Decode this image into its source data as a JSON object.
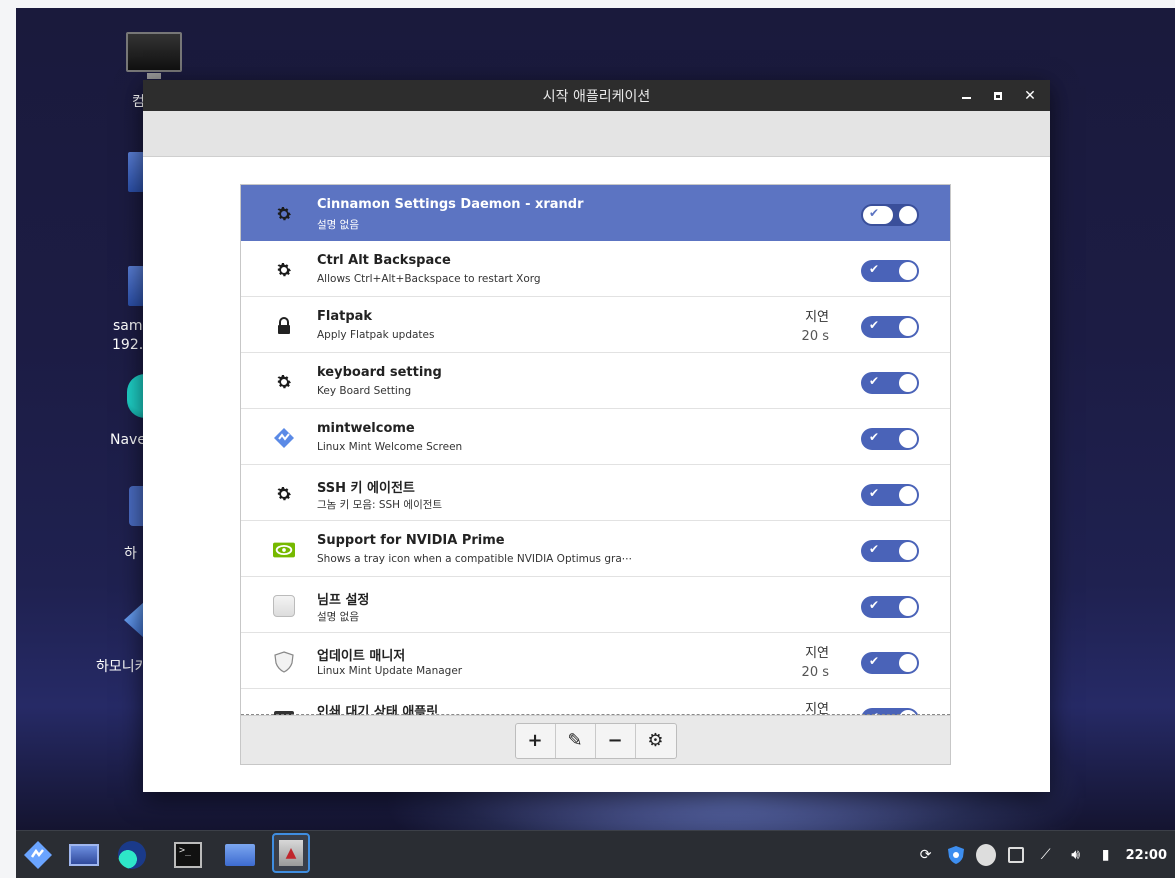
{
  "window": {
    "title": "시작 애플리케이션"
  },
  "desktop": {
    "labels": [
      "컴",
      "sam",
      "192.",
      "Nave",
      "하",
      "하모니카"
    ]
  },
  "startup_apps": [
    {
      "title": "Cinnamon Settings Daemon - xrandr",
      "description": "설명 없음",
      "icon": "gear-icon",
      "delay_label": "",
      "delay_value": "",
      "enabled": true,
      "selected": true
    },
    {
      "title": "Ctrl Alt Backspace",
      "description": "Allows Ctrl+Alt+Backspace to restart Xorg",
      "icon": "gear-icon",
      "delay_label": "",
      "delay_value": "",
      "enabled": true,
      "selected": false
    },
    {
      "title": "Flatpak",
      "description": "Apply Flatpak updates",
      "icon": "lock-icon",
      "delay_label": "지연",
      "delay_value": "20 s",
      "enabled": true,
      "selected": false
    },
    {
      "title": "keyboard setting",
      "description": "Key Board Setting",
      "icon": "gear-icon",
      "delay_label": "",
      "delay_value": "",
      "enabled": true,
      "selected": false
    },
    {
      "title": "mintwelcome",
      "description": "Linux Mint Welcome Screen",
      "icon": "mint-logo-icon",
      "delay_label": "",
      "delay_value": "",
      "enabled": true,
      "selected": false
    },
    {
      "title": "SSH 키 에이전트",
      "description": "그놈 키 모음: SSH 에이전트",
      "icon": "gear-icon",
      "delay_label": "",
      "delay_value": "",
      "enabled": true,
      "selected": false
    },
    {
      "title": "Support for NVIDIA Prime",
      "description": "Shows a tray icon when a compatible NVIDIA Optimus gra⋯",
      "icon": "nvidia-icon",
      "delay_label": "",
      "delay_value": "",
      "enabled": true,
      "selected": false
    },
    {
      "title": "님프 설정",
      "description": "설명 없음",
      "icon": "blank-app-icon",
      "delay_label": "",
      "delay_value": "",
      "enabled": true,
      "selected": false
    },
    {
      "title": "업데이트 매니저",
      "description": "Linux Mint Update Manager",
      "icon": "shield-icon",
      "delay_label": "지연",
      "delay_value": "20 s",
      "enabled": true,
      "selected": false
    },
    {
      "title": "인쇄 대기 상태 애플릿",
      "description": "",
      "icon": "printer-icon",
      "delay_label": "지연",
      "delay_value": "",
      "enabled": true,
      "selected": false
    }
  ],
  "toolbar_buttons": [
    {
      "name": "add-button",
      "glyph": "+"
    },
    {
      "name": "edit-button",
      "glyph": "✎"
    },
    {
      "name": "remove-button",
      "glyph": "−"
    },
    {
      "name": "run-now-button",
      "glyph": "⚙"
    }
  ],
  "taskbar": {
    "clock": "22:00"
  },
  "colors": {
    "selected_row": "#5c74c2",
    "toggle_on": "#4a63b8",
    "titlebar": "#2d2d2d"
  }
}
